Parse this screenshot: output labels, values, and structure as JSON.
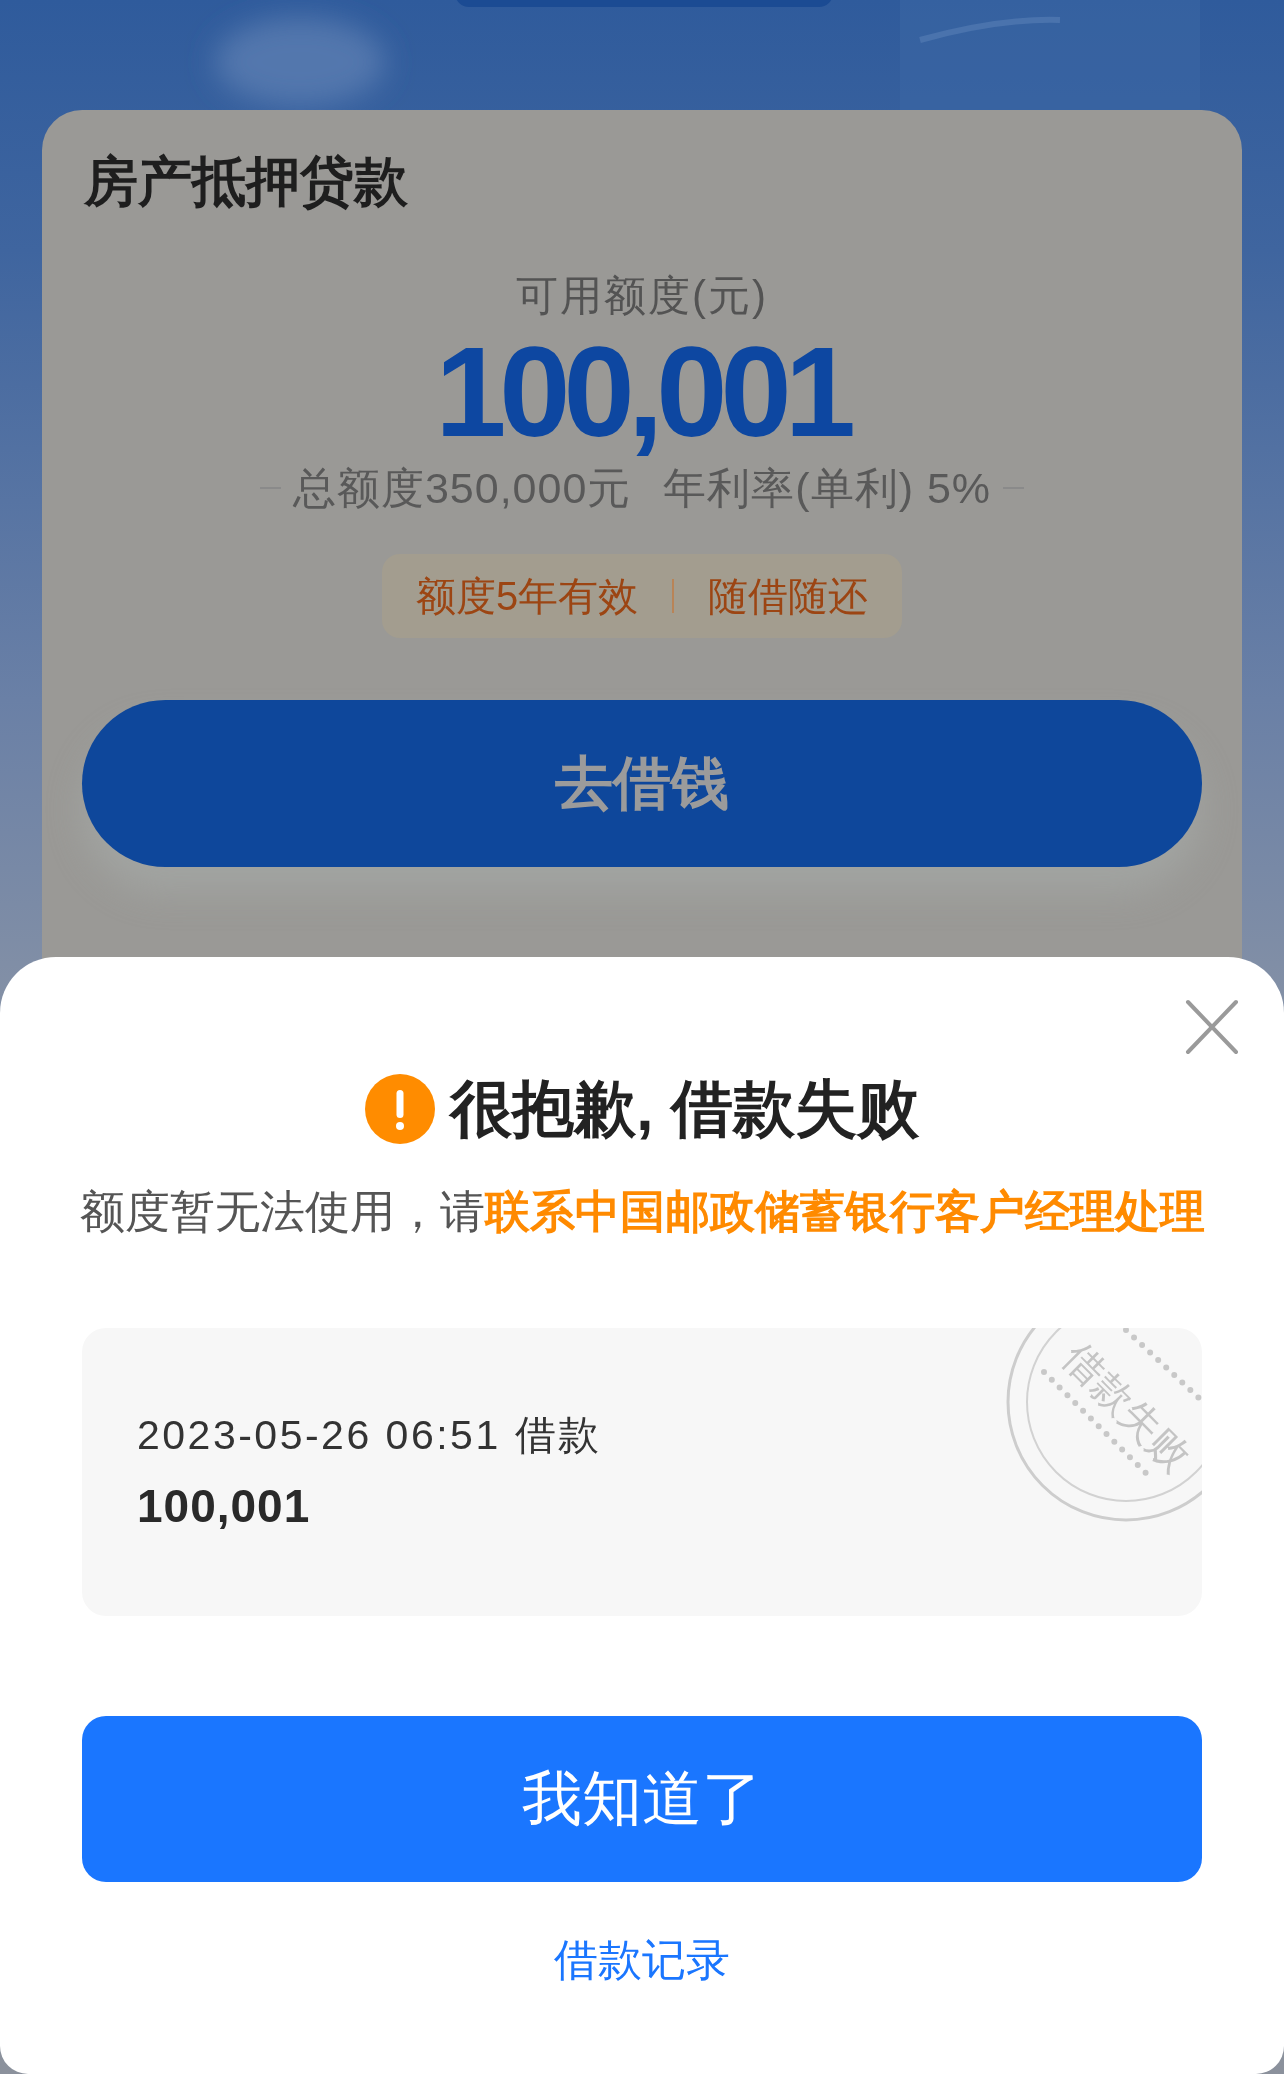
{
  "loan_card": {
    "title": "房产抵押贷款",
    "limit_label": "可用额度(元)",
    "available_amount": "100,001",
    "total_limit": "总额度350,000元",
    "annual_rate": "年利率(单利) 5%",
    "tags": [
      "额度5年有效",
      "随借随还"
    ],
    "button": "去借钱"
  },
  "dialog": {
    "title": "很抱歉, 借款失败",
    "message": "额度暂无法使用，请**联系中国邮政储蓄银行客户经理处理**",
    "record": {
      "time": "2023-05-26 06:51 借款",
      "amount": "100,001",
      "stamp": "借款失败"
    },
    "confirm_button": "我知道了",
    "link": "借款记录"
  }
}
